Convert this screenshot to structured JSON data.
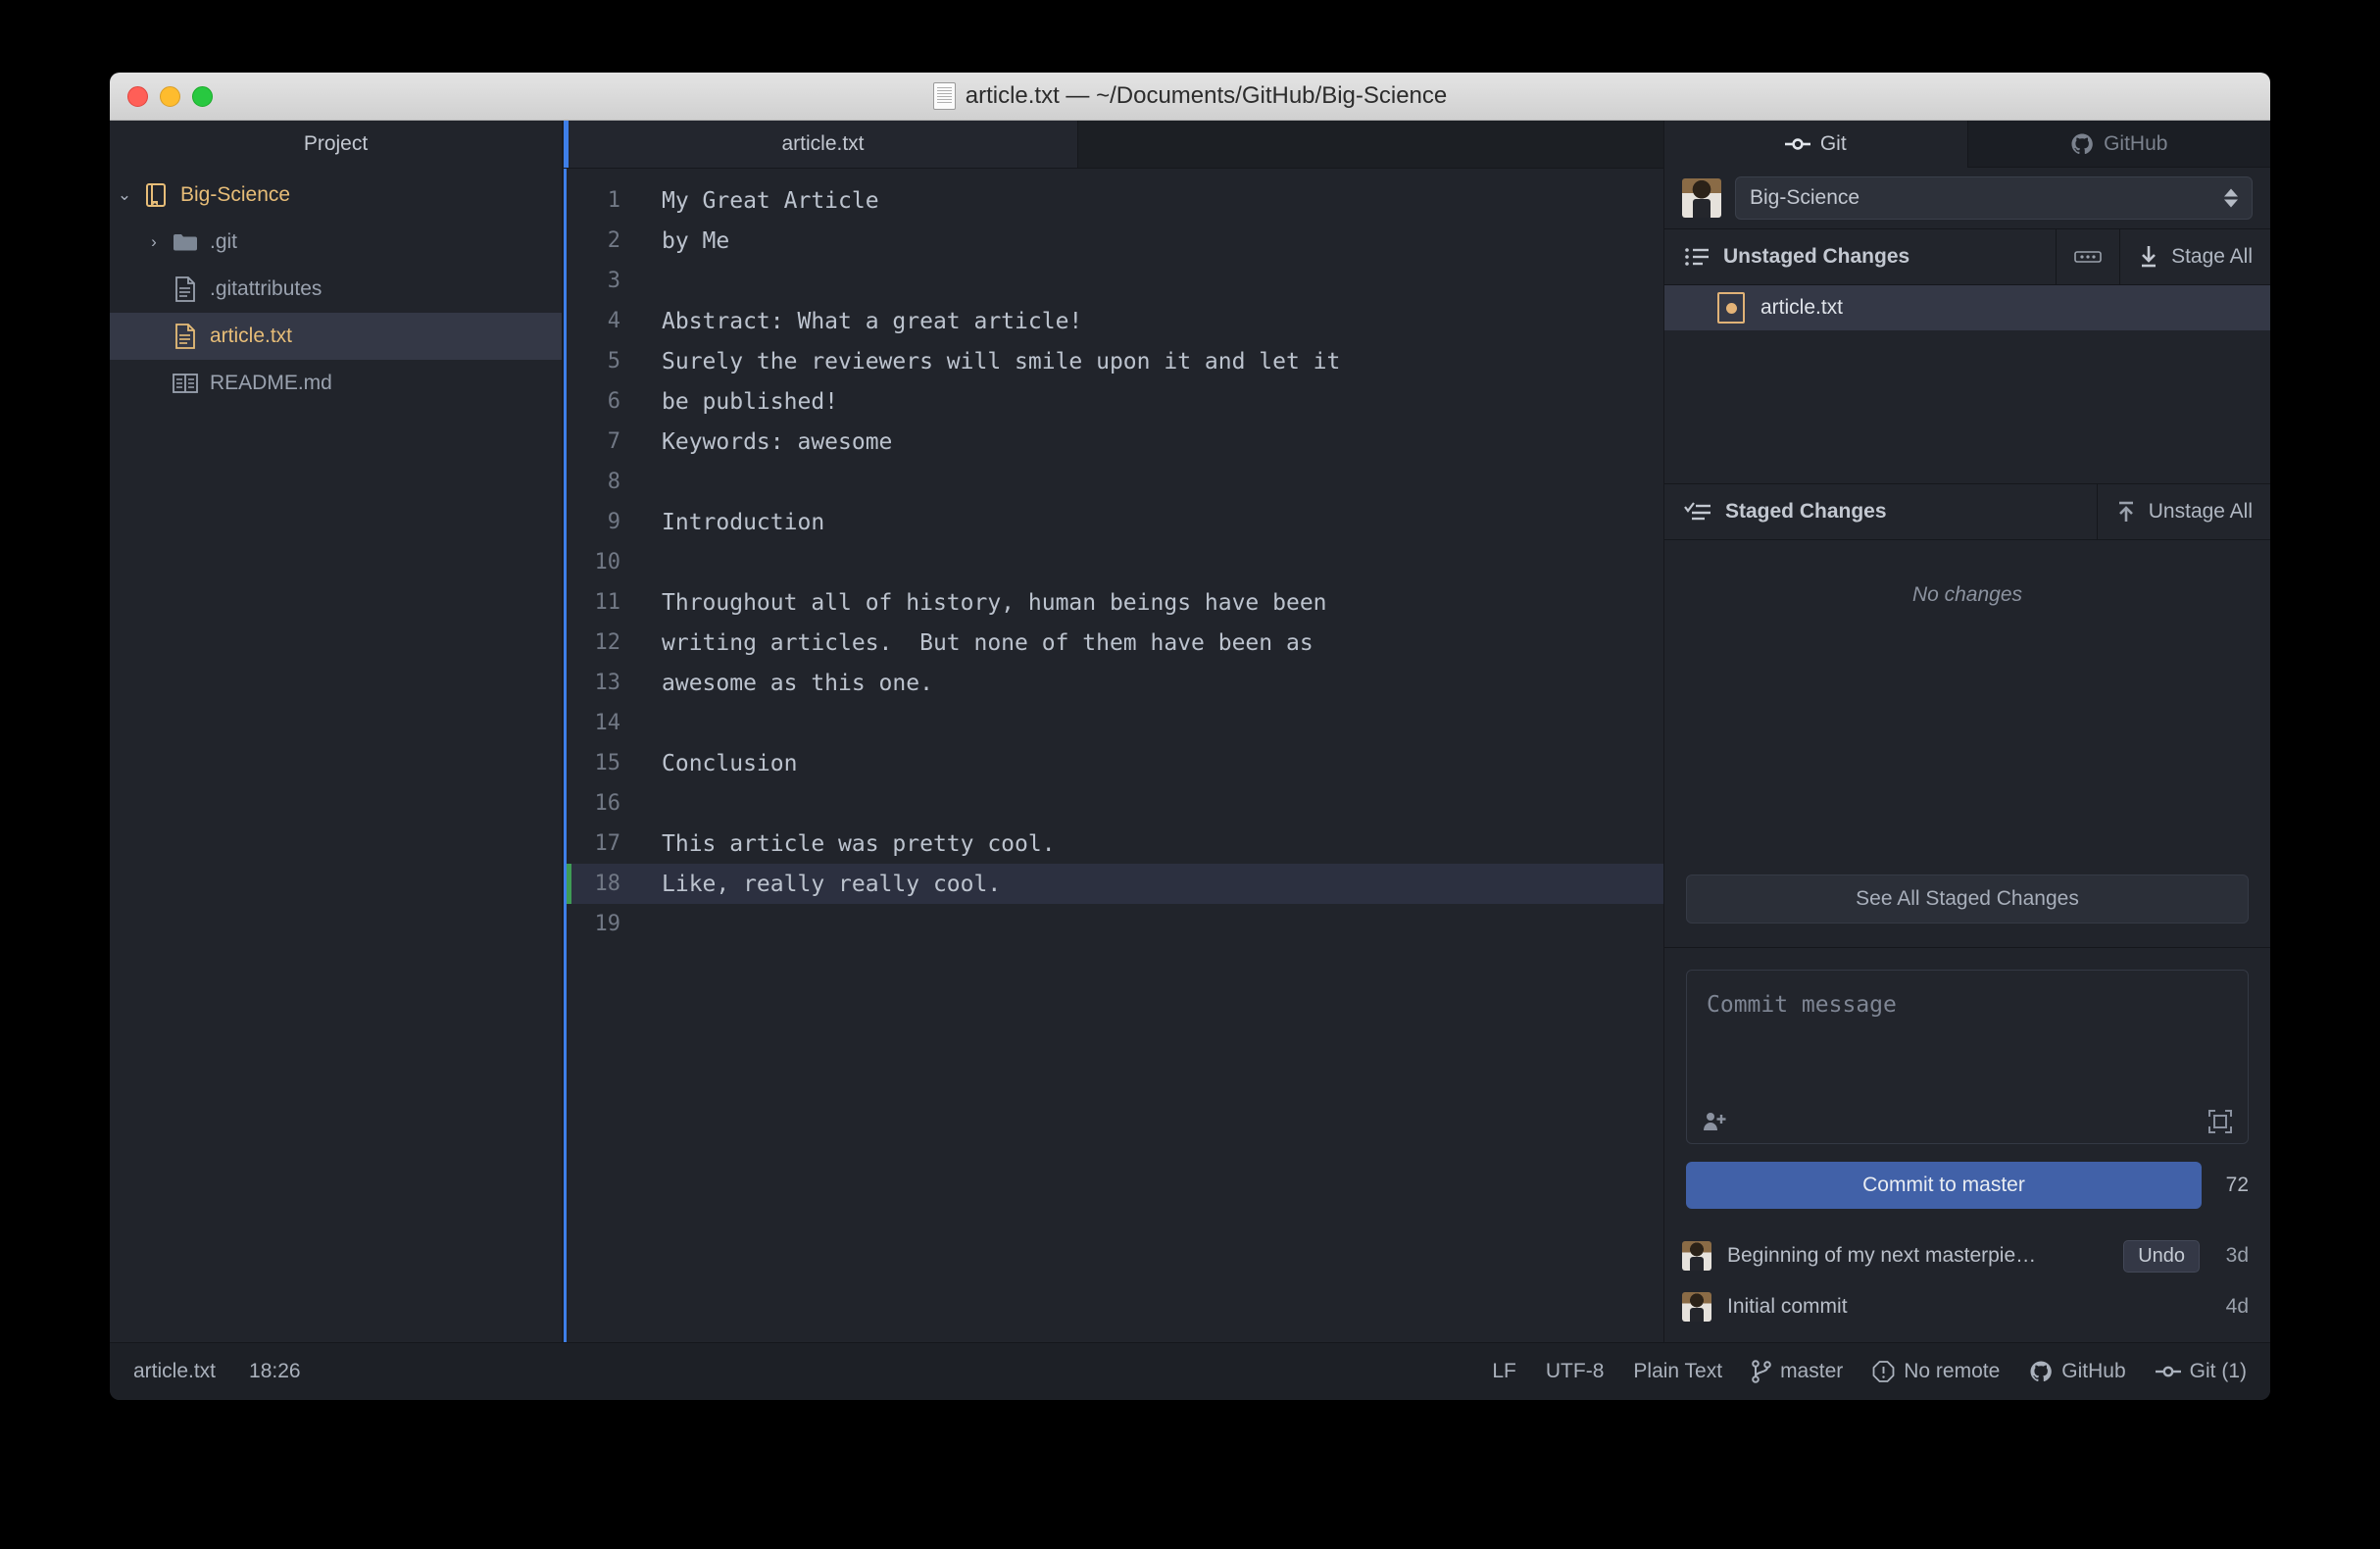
{
  "window": {
    "title": "article.txt — ~/Documents/GitHub/Big-Science",
    "title_icon": "document-icon"
  },
  "sidebar": {
    "header": "Project",
    "tree": [
      {
        "label": "Big-Science",
        "icon": "repository-book-icon",
        "twisty": "⌄",
        "selected": false,
        "kind": "root"
      },
      {
        "label": ".git",
        "icon": "folder-icon",
        "twisty": "›",
        "selected": false,
        "kind": "folder"
      },
      {
        "label": ".gitattributes",
        "icon": "file-text-icon",
        "twisty": "",
        "selected": false,
        "kind": "file"
      },
      {
        "label": "article.txt",
        "icon": "file-text-icon",
        "twisty": "",
        "selected": true,
        "kind": "file-active"
      },
      {
        "label": "README.md",
        "icon": "file-markdown-icon",
        "twisty": "",
        "selected": false,
        "kind": "file"
      }
    ]
  },
  "editor": {
    "tab_label": "article.txt",
    "current_line": 18,
    "modified_lines": [
      18
    ],
    "lines": [
      {
        "n": "1",
        "text": "My Great Article"
      },
      {
        "n": "2",
        "text": "by Me"
      },
      {
        "n": "3",
        "text": ""
      },
      {
        "n": "4",
        "text": "Abstract: What a great article!"
      },
      {
        "n": "5",
        "text": "Surely the reviewers will smile upon it and let it"
      },
      {
        "n": "6",
        "text": "be published!"
      },
      {
        "n": "7",
        "text": "Keywords: awesome"
      },
      {
        "n": "8",
        "text": ""
      },
      {
        "n": "9",
        "text": "Introduction"
      },
      {
        "n": "10",
        "text": ""
      },
      {
        "n": "11",
        "text": "Throughout all of history, human beings have been"
      },
      {
        "n": "12",
        "text": "writing articles.  But none of them have been as"
      },
      {
        "n": "13",
        "text": "awesome as this one."
      },
      {
        "n": "14",
        "text": ""
      },
      {
        "n": "15",
        "text": "Conclusion"
      },
      {
        "n": "16",
        "text": ""
      },
      {
        "n": "17",
        "text": "This article was pretty cool."
      },
      {
        "n": "18",
        "text": "Like, really really cool."
      },
      {
        "n": "19",
        "text": ""
      }
    ]
  },
  "git_panel": {
    "tabs": [
      {
        "label": "Git",
        "icon": "git-commit-icon",
        "active": true
      },
      {
        "label": "GitHub",
        "icon": "octocat-icon",
        "active": false
      }
    ],
    "repository": "Big-Science",
    "unstaged": {
      "title": "Unstaged Changes",
      "title_icon": "list-unordered-icon",
      "more_button_icon": "ellipsis-icon",
      "action_label": "Stage All",
      "action_icon": "arrow-down-to-line-icon",
      "files": [
        {
          "name": "article.txt",
          "status": "modified",
          "selected": true
        }
      ]
    },
    "staged": {
      "title": "Staged Changes",
      "title_icon": "checklist-icon",
      "action_label": "Unstage All",
      "action_icon": "arrow-up-to-line-icon",
      "empty_text": "No changes",
      "see_all_label": "See All Staged Changes"
    },
    "commit": {
      "placeholder": "Commit message",
      "coauthor_icon": "add-person-icon",
      "expand_icon": "expand-icon",
      "button_label": "Commit to master",
      "char_count": "72"
    },
    "history": [
      {
        "message": "Beginning of my next masterpie…",
        "undo_label": "Undo",
        "age": "3d",
        "avatar": "user-avatar"
      },
      {
        "message": "Initial commit",
        "undo_label": "",
        "age": "4d",
        "avatar": "user-avatar"
      }
    ]
  },
  "statusbar": {
    "filename": "article.txt",
    "time": "18:26",
    "line_ending": "LF",
    "encoding": "UTF-8",
    "grammar": "Plain Text",
    "branch": "master",
    "branch_icon": "git-branch-icon",
    "remote": "No remote",
    "remote_icon": "alert-icon",
    "github": "GitHub",
    "github_icon": "octocat-icon",
    "git": "Git (1)",
    "git_icon": "git-commit-icon"
  },
  "colors": {
    "accent_blue": "#3e7fe8",
    "commit_button": "#4161a8",
    "selection": "#343846",
    "highlight_gold": "#e7bd78",
    "modified_green": "#3f9c56",
    "panel_bg": "#21242b"
  }
}
